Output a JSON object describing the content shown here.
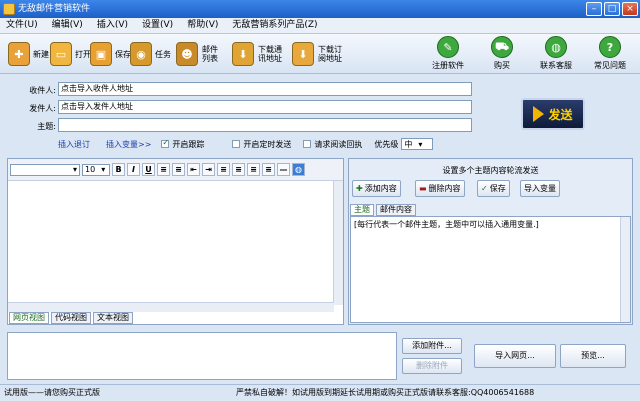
{
  "window": {
    "title": "无敌邮件营销软件"
  },
  "menu": [
    "文件(U)",
    "编辑(V)",
    "插入(V)",
    "设置(V)",
    "帮助(V)",
    "无敌营销系列产品(Z)"
  ],
  "toolbar_left": [
    {
      "label": "新建",
      "icon": "new-icon",
      "color": "#e9a13a"
    },
    {
      "label": "打开",
      "icon": "folder-icon",
      "color": "#f0b640"
    },
    {
      "label": "保存",
      "icon": "save-icon",
      "color": "#e8a030"
    },
    {
      "label": "任务",
      "icon": "task-icon",
      "color": "#d69a2c"
    },
    {
      "label": "邮件列表",
      "icon": "contacts-icon",
      "color": "#c98a2a"
    },
    {
      "label": "下载通讯地址",
      "icon": "download-icon",
      "color": "#e0a435"
    },
    {
      "label": "下载订阅地址",
      "icon": "subscribe-icon",
      "color": "#e8a83c"
    }
  ],
  "toolbar_right": [
    {
      "label": "注册软件",
      "icon": "register-icon",
      "color": "#3ea83e"
    },
    {
      "label": "购买",
      "icon": "cart-icon",
      "color": "#3ea83e"
    },
    {
      "label": "联系客服",
      "icon": "globe-icon",
      "color": "#3ea83e"
    },
    {
      "label": "常见问题",
      "icon": "help-icon",
      "color": "#3ea83e"
    }
  ],
  "form": {
    "recipient_label": "收件人:",
    "recipient_value": "点击导入收件人地址",
    "sender_label": "发件人:",
    "sender_value": "点击导入发件人地址",
    "subject_label": "主题:",
    "subject_value": ""
  },
  "send_button": "发送",
  "options": {
    "insert_unsubscribe": "插入退订",
    "insert_variable": "插入变量>>",
    "tracking": "开启跟踪",
    "tracking_checked": true,
    "timed_send": "开启定时发送",
    "timed_checked": false,
    "read_receipt": "请求阅读回执",
    "receipt_checked": false,
    "priority_label": "优先级",
    "priority_value": "中"
  },
  "editor": {
    "font_size": "10",
    "tabs": [
      "网页视图",
      "代码视图",
      "文本视图"
    ],
    "active_tab": 0
  },
  "subject_panel": {
    "title": "设置多个主题内容轮流发送",
    "add": "添加内容",
    "delete": "删除内容",
    "save": "保存",
    "import": "导入变量",
    "tabs": [
      "主题",
      "邮件内容"
    ],
    "content": "[每行代表一个邮件主题，主题中可以插入通用变量.]"
  },
  "attachments": {
    "add": "添加附件...",
    "delete": "删除附件",
    "import_web": "导入网页...",
    "preview": "预览..."
  },
  "status": {
    "left": "试用版——请您购买正式版",
    "right": "严禁私自破解！如试用版到期延长试用期或购买正式版请联系客服:QQ4006541688"
  }
}
